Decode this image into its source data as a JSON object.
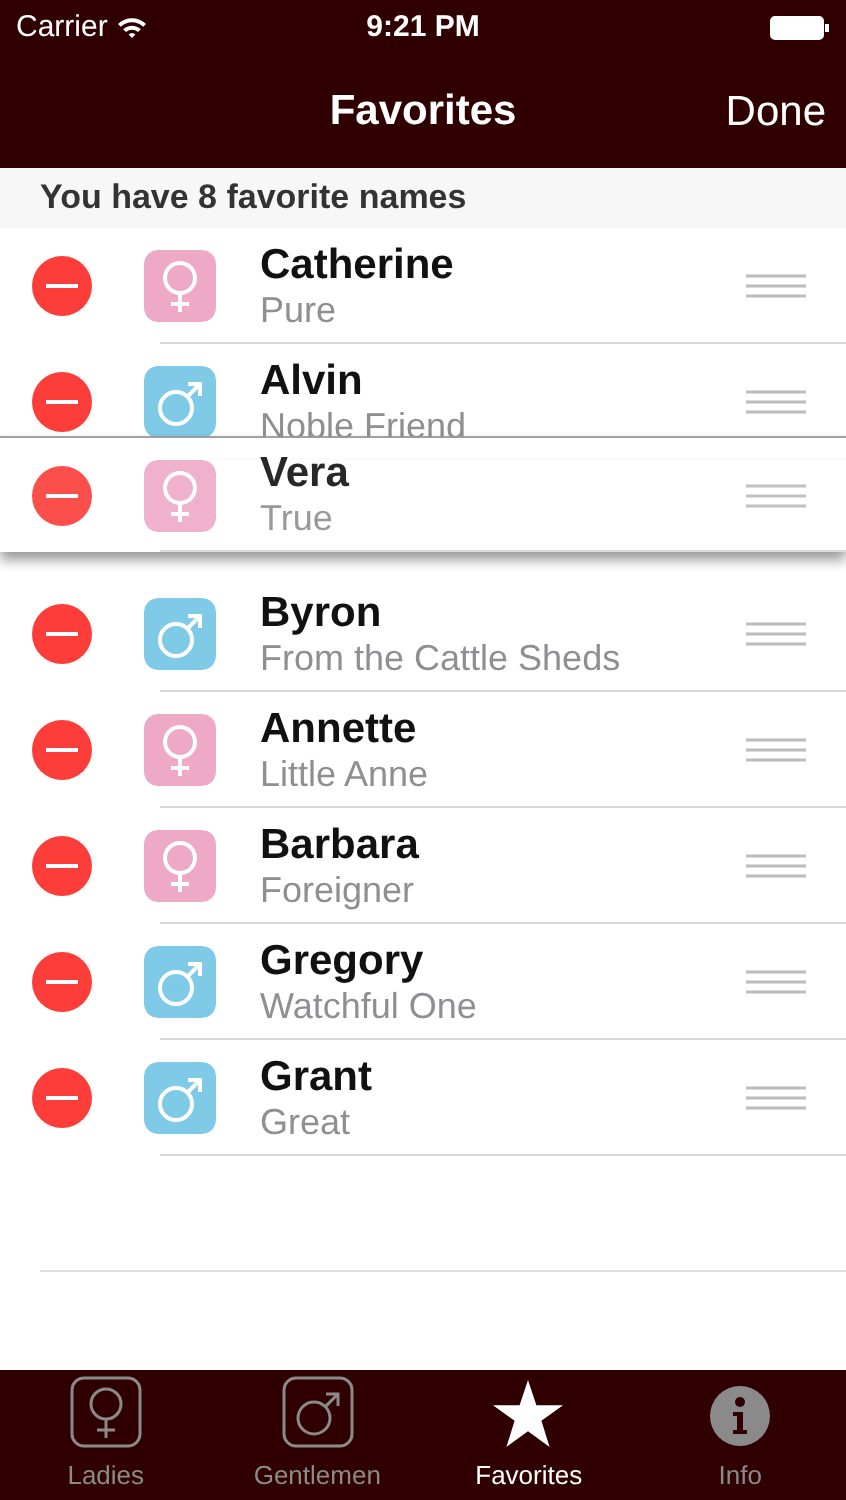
{
  "status_bar": {
    "carrier": "Carrier",
    "time": "9:21 PM"
  },
  "nav_bar": {
    "title": "Favorites",
    "done": "Done"
  },
  "section_header": "You have 8 favorite names",
  "names": [
    {
      "name": "Catherine",
      "meaning": "Pure",
      "kind": "female",
      "dragging": false
    },
    {
      "name": "Alvin",
      "meaning": "Noble Friend",
      "kind": "male",
      "dragging": false
    },
    {
      "name": "Vera",
      "meaning": "True",
      "kind": "female",
      "dragging": true
    },
    {
      "name": "Byron",
      "meaning": "From the Cattle Sheds",
      "kind": "male",
      "dragging": false
    },
    {
      "name": "Annette",
      "meaning": "Little Anne",
      "kind": "female",
      "dragging": false
    },
    {
      "name": "Barbara",
      "meaning": "Foreigner",
      "kind": "female",
      "dragging": false
    },
    {
      "name": "Gregory",
      "meaning": "Watchful One",
      "kind": "male",
      "dragging": false
    },
    {
      "name": "Grant",
      "meaning": "Great",
      "kind": "male",
      "dragging": false
    }
  ],
  "tabs": [
    {
      "label": "Ladies",
      "kind": "female",
      "selected": false
    },
    {
      "label": "Gentlemen",
      "kind": "male",
      "selected": false
    },
    {
      "label": "Favorites",
      "kind": "star",
      "selected": true
    },
    {
      "label": "Info",
      "kind": "info",
      "selected": false
    }
  ]
}
